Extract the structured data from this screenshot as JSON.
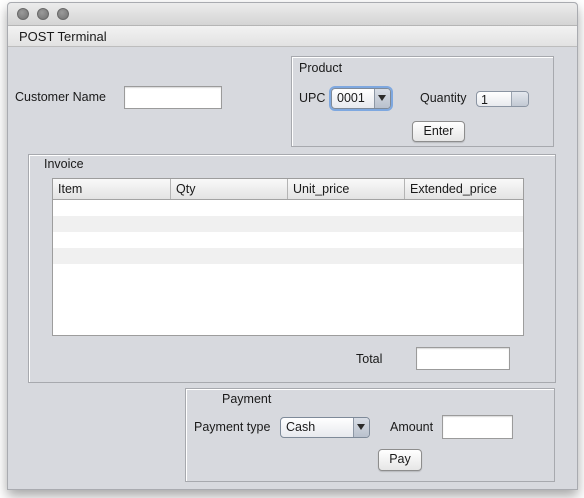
{
  "tab": {
    "title": "POST Terminal"
  },
  "customer": {
    "label": "Customer Name",
    "value": ""
  },
  "product": {
    "title": "Product",
    "upc_label": "UPC",
    "upc_value": "0001",
    "quantity_label": "Quantity",
    "quantity_value": "1",
    "enter_label": "Enter"
  },
  "invoice": {
    "title": "Invoice",
    "columns": [
      "Item",
      "Qty",
      "Unit_price",
      "Extended_price"
    ],
    "total_label": "Total",
    "total_value": ""
  },
  "payment": {
    "title": "Payment",
    "type_label": "Payment type",
    "type_value": "Cash",
    "amount_label": "Amount",
    "amount_value": "",
    "pay_label": "Pay"
  }
}
